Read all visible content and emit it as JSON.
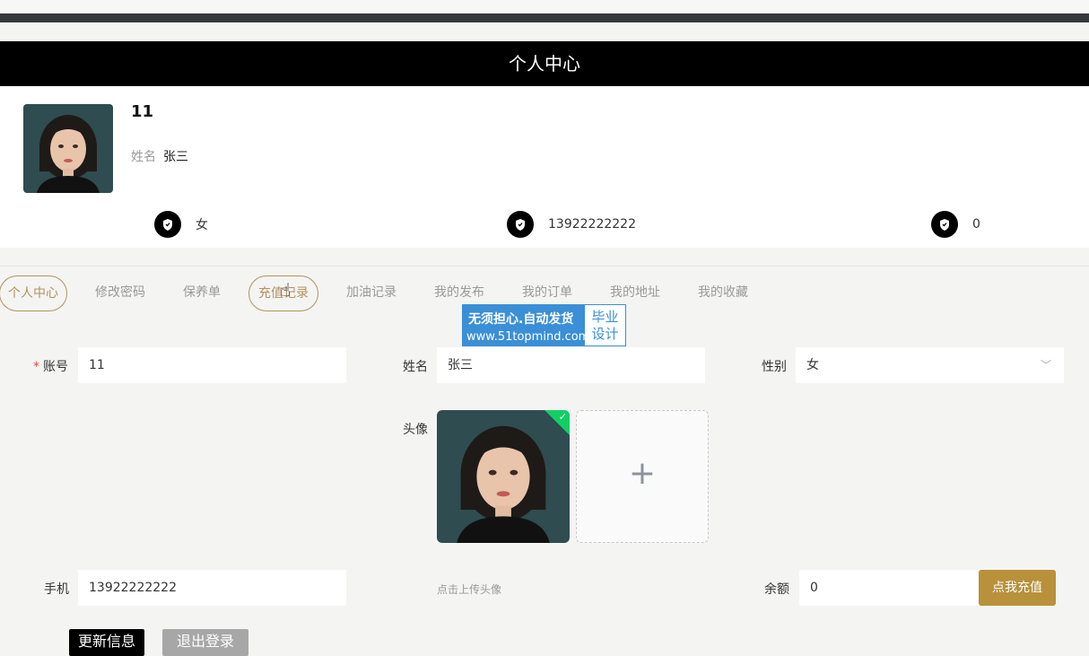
{
  "header": {
    "title": "个人中心"
  },
  "profile": {
    "username": "11",
    "name_label": "姓名",
    "name_value": "张三",
    "stats": [
      {
        "icon": "shield-icon",
        "value": "女"
      },
      {
        "icon": "shield-icon",
        "value": "13922222222"
      },
      {
        "icon": "shield-icon",
        "value": "0"
      }
    ]
  },
  "tabs": [
    {
      "label": "个人中心",
      "active": true
    },
    {
      "label": "修改密码"
    },
    {
      "label": "保养单"
    },
    {
      "label": "充值记录",
      "hovered": true
    },
    {
      "label": "加油记录"
    },
    {
      "label": "我的发布"
    },
    {
      "label": "我的订单"
    },
    {
      "label": "我的地址"
    },
    {
      "label": "我的收藏"
    }
  ],
  "watermark": {
    "line1": "无须担心.自动发货",
    "line2": "www.51topmind.com",
    "badge_line1": "毕业",
    "badge_line2": "设计"
  },
  "form": {
    "account_label": "账号",
    "account_value": "11",
    "name_label": "姓名",
    "name_value": "张三",
    "gender_label": "性别",
    "gender_value": "女",
    "avatar_label": "头像",
    "upload_hint": "点击上传头像",
    "phone_label": "手机",
    "phone_value": "13922222222",
    "balance_label": "余额",
    "balance_value": "0",
    "recharge_button": "点我充值",
    "update_button": "更新信息",
    "logout_button": "退出登录"
  },
  "colors": {
    "accent": "#b8913a",
    "header_bg": "#000000",
    "upload_ok": "#13ce66"
  }
}
